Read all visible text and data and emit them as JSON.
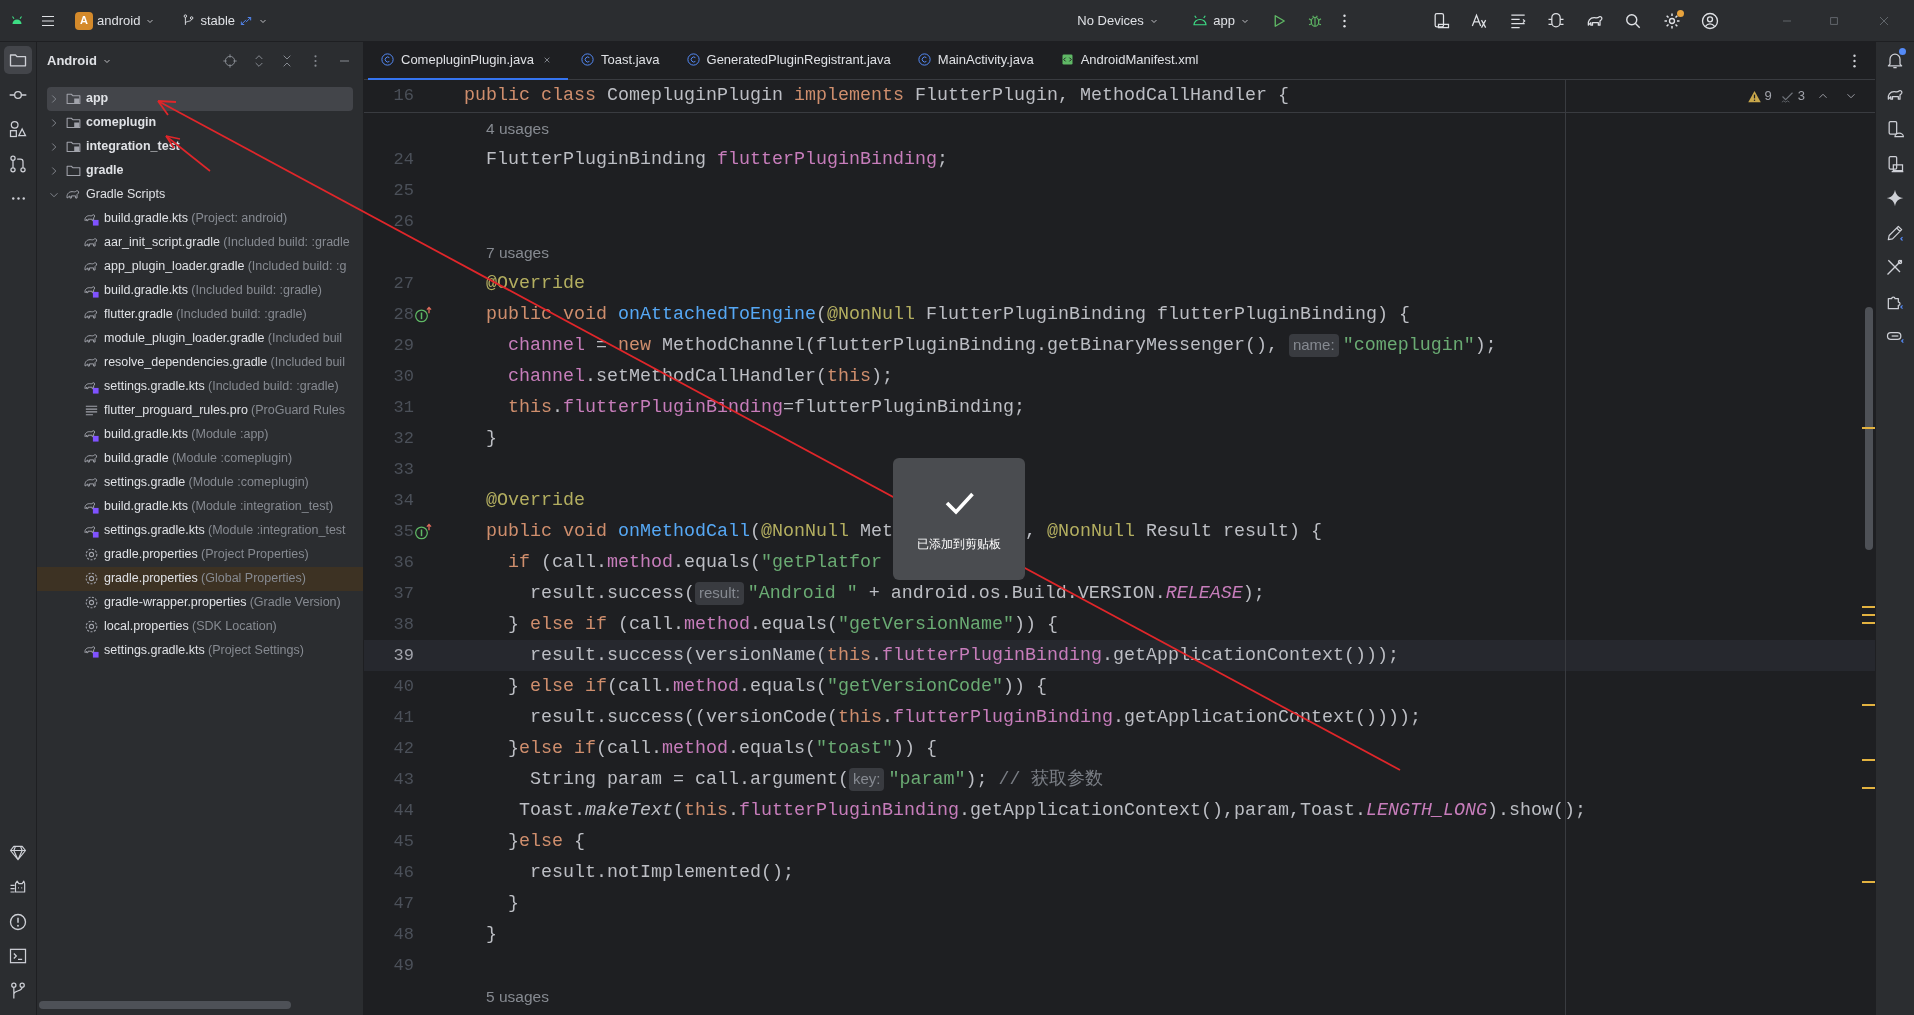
{
  "title_bar": {
    "project_initial": "A",
    "project": "android",
    "branch": "stable",
    "device": "No Devices",
    "run_config": "app",
    "update_available": true
  },
  "tool_strip_left": [
    {
      "kind": "project",
      "selected": true
    },
    {
      "kind": "commit",
      "selected": false
    },
    {
      "kind": "resources",
      "selected": false
    },
    {
      "kind": "pull-requests",
      "selected": false
    },
    {
      "kind": "more",
      "selected": false
    }
  ],
  "tool_strip_left_bottom": [
    {
      "kind": "gem",
      "selected": false
    },
    {
      "kind": "cat",
      "selected": false
    },
    {
      "kind": "problems",
      "selected": false
    },
    {
      "kind": "terminal",
      "selected": false
    },
    {
      "kind": "git",
      "selected": false
    }
  ],
  "tool_strip_right": [
    {
      "kind": "notifications",
      "selected": false,
      "badge": true
    },
    {
      "kind": "gradle",
      "selected": false,
      "badge": false
    },
    {
      "kind": "device-manager",
      "selected": false,
      "badge": false
    },
    {
      "kind": "running-devices",
      "selected": false,
      "badge": false
    },
    {
      "kind": "sparkle",
      "selected": false,
      "badge": false
    },
    {
      "kind": "pencil",
      "selected": false,
      "badge": false
    },
    {
      "kind": "tools",
      "selected": false,
      "badge": false
    },
    {
      "kind": "puzzle",
      "selected": false,
      "badge": false
    },
    {
      "kind": "link",
      "selected": false,
      "badge": false
    }
  ],
  "project_panel": {
    "title": "Android",
    "tree": [
      {
        "label": "app",
        "kind": "module",
        "selected": true,
        "expanded": false
      },
      {
        "label": "comeplugin",
        "kind": "module",
        "selected": false,
        "expanded": false
      },
      {
        "label": "integration_test",
        "kind": "module",
        "selected": false,
        "expanded": false
      },
      {
        "label": "gradle",
        "kind": "folder",
        "selected": false,
        "expanded": false
      },
      {
        "label": "Gradle Scripts",
        "kind": "scripts",
        "selected": false,
        "expanded": true,
        "children": [
          {
            "label": "build.gradle.kts",
            "detail": "(Project: android)",
            "kind": "gradle-kts",
            "highlighted": false
          },
          {
            "label": "aar_init_script.gradle",
            "detail": "(Included build: :gradle",
            "kind": "gradle",
            "highlighted": false
          },
          {
            "label": "app_plugin_loader.gradle",
            "detail": "(Included build: :g",
            "kind": "gradle",
            "highlighted": false
          },
          {
            "label": "build.gradle.kts",
            "detail": "(Included build: :gradle)",
            "kind": "gradle-kts",
            "highlighted": false
          },
          {
            "label": "flutter.gradle",
            "detail": "(Included build: :gradle)",
            "kind": "gradle",
            "highlighted": false
          },
          {
            "label": "module_plugin_loader.gradle",
            "detail": "(Included buil",
            "kind": "gradle",
            "highlighted": false
          },
          {
            "label": "resolve_dependencies.gradle",
            "detail": "(Included buil",
            "kind": "gradle",
            "highlighted": false
          },
          {
            "label": "settings.gradle.kts",
            "detail": "(Included build: :gradle)",
            "kind": "gradle-kts",
            "highlighted": false
          },
          {
            "label": "flutter_proguard_rules.pro",
            "detail": "(ProGuard Rules",
            "kind": "text",
            "highlighted": false
          },
          {
            "label": "build.gradle.kts",
            "detail": "(Module :app)",
            "kind": "gradle-kts",
            "highlighted": false
          },
          {
            "label": "build.gradle",
            "detail": "(Module :comeplugin)",
            "kind": "gradle",
            "highlighted": false
          },
          {
            "label": "settings.gradle",
            "detail": "(Module :comeplugin)",
            "kind": "gradle",
            "highlighted": false
          },
          {
            "label": "build.gradle.kts",
            "detail": "(Module :integration_test)",
            "kind": "gradle-kts",
            "highlighted": false
          },
          {
            "label": "settings.gradle.kts",
            "detail": "(Module :integration_test",
            "kind": "gradle-kts",
            "highlighted": false
          },
          {
            "label": "gradle.properties",
            "detail": "(Project Properties)",
            "kind": "properties",
            "highlighted": false
          },
          {
            "label": "gradle.properties",
            "detail": "(Global Properties)",
            "kind": "properties",
            "highlighted": true
          },
          {
            "label": "gradle-wrapper.properties",
            "detail": "(Gradle Version)",
            "kind": "properties",
            "highlighted": false
          },
          {
            "label": "local.properties",
            "detail": "(SDK Location)",
            "kind": "properties",
            "highlighted": false
          },
          {
            "label": "settings.gradle.kts",
            "detail": "(Project Settings)",
            "kind": "gradle-kts",
            "highlighted": false
          }
        ]
      }
    ]
  },
  "editor": {
    "tabs": [
      {
        "label": "ComepluginPlugin.java",
        "kind": "java",
        "selected": true
      },
      {
        "label": "Toast.java",
        "kind": "java",
        "selected": false
      },
      {
        "label": "GeneratedPluginRegistrant.java",
        "kind": "java",
        "selected": false
      },
      {
        "label": "MainActivity.java",
        "kind": "java",
        "selected": false
      },
      {
        "label": "AndroidManifest.xml",
        "kind": "xml",
        "selected": false
      }
    ],
    "inspections": {
      "warnings": "9",
      "weak_warnings": "3"
    },
    "lines": [
      {
        "kind": "code",
        "number": "16",
        "sticky": true,
        "current": false,
        "implements_marker": false,
        "tokens": [
          {
            "kind": "kw",
            "text": "public class "
          },
          {
            "kind": "plain",
            "text": "ComepluginPlugin "
          },
          {
            "kind": "kw",
            "text": "implements "
          },
          {
            "kind": "plain",
            "text": "FlutterPlugin, MethodCallHandler {"
          }
        ]
      },
      {
        "kind": "usages",
        "text": "4 usages"
      },
      {
        "kind": "code",
        "number": "24",
        "sticky": false,
        "current": false,
        "implements_marker": false,
        "tokens": [
          {
            "kind": "plain",
            "text": "  FlutterPluginBinding "
          },
          {
            "kind": "field",
            "text": "flutterPluginBinding"
          },
          {
            "kind": "plain",
            "text": ";"
          }
        ]
      },
      {
        "kind": "code",
        "number": "25",
        "sticky": false,
        "current": false,
        "implements_marker": false
      },
      {
        "kind": "code",
        "number": "26",
        "sticky": false,
        "current": false,
        "implements_marker": false
      },
      {
        "kind": "usages",
        "text": "7 usages"
      },
      {
        "kind": "code",
        "number": "27",
        "sticky": false,
        "current": false,
        "implements_marker": false,
        "tokens": [
          {
            "kind": "ann",
            "text": "  @Override"
          }
        ]
      },
      {
        "kind": "code",
        "number": "28",
        "sticky": false,
        "current": false,
        "implements_marker": true,
        "tokens": [
          {
            "kind": "kw",
            "text": "  public void "
          },
          {
            "kind": "fn",
            "text": "onAttachedToEngine"
          },
          {
            "kind": "plain",
            "text": "("
          },
          {
            "kind": "ann",
            "text": "@NonNull"
          },
          {
            "kind": "plain",
            "text": " FlutterPluginBinding flutterPluginBinding) {"
          }
        ]
      },
      {
        "kind": "code",
        "number": "29",
        "sticky": false,
        "current": false,
        "implements_marker": false,
        "tokens": [
          {
            "kind": "field",
            "text": "    channel"
          },
          {
            "kind": "plain",
            "text": " = "
          },
          {
            "kind": "kw",
            "text": "new "
          },
          {
            "kind": "plain",
            "text": "MethodChannel(flutterPluginBinding.getBinaryMessenger(), "
          },
          {
            "kind": "hint",
            "text": "name:"
          },
          {
            "kind": "str",
            "text": "\"comeplugin\""
          },
          {
            "kind": "plain",
            "text": ");"
          }
        ]
      },
      {
        "kind": "code",
        "number": "30",
        "sticky": false,
        "current": false,
        "implements_marker": false,
        "tokens": [
          {
            "kind": "field",
            "text": "    channel"
          },
          {
            "kind": "plain",
            "text": ".setMethodCallHandler("
          },
          {
            "kind": "kw",
            "text": "this"
          },
          {
            "kind": "plain",
            "text": ");"
          }
        ]
      },
      {
        "kind": "code",
        "number": "31",
        "sticky": false,
        "current": false,
        "implements_marker": false,
        "tokens": [
          {
            "kind": "kw",
            "text": "    this"
          },
          {
            "kind": "plain",
            "text": "."
          },
          {
            "kind": "field",
            "text": "flutterPluginBinding"
          },
          {
            "kind": "plain",
            "text": "=flutterPluginBinding;"
          }
        ]
      },
      {
        "kind": "code",
        "number": "32",
        "sticky": false,
        "current": false,
        "implements_marker": false,
        "tokens": [
          {
            "kind": "plain",
            "text": "  }"
          }
        ]
      },
      {
        "kind": "code",
        "number": "33",
        "sticky": false,
        "current": false,
        "implements_marker": false
      },
      {
        "kind": "code",
        "number": "34",
        "sticky": false,
        "current": false,
        "implements_marker": false,
        "tokens": [
          {
            "kind": "ann",
            "text": "  @Override"
          }
        ]
      },
      {
        "kind": "code",
        "number": "35",
        "sticky": false,
        "current": false,
        "implements_marker": true,
        "tokens": [
          {
            "kind": "kw",
            "text": "  public void "
          },
          {
            "kind": "fn",
            "text": "onMethodCall"
          },
          {
            "kind": "plain",
            "text": "("
          },
          {
            "kind": "ann",
            "text": "@NonNull"
          },
          {
            "kind": "plain",
            "text": " Met"
          }
        ],
        "after_toast": [
          {
            "kind": "plain",
            "text": ", "
          },
          {
            "kind": "ann",
            "text": "@NonNull"
          },
          {
            "kind": "plain",
            "text": " Result result) {"
          }
        ]
      },
      {
        "kind": "code",
        "number": "36",
        "sticky": false,
        "current": false,
        "implements_marker": false,
        "tokens": [
          {
            "kind": "kw",
            "text": "    if "
          },
          {
            "kind": "plain",
            "text": "(call."
          },
          {
            "kind": "field",
            "text": "method"
          },
          {
            "kind": "plain",
            "text": ".equals("
          },
          {
            "kind": "str",
            "text": "\"getPlatfor"
          }
        ]
      },
      {
        "kind": "code",
        "number": "37",
        "sticky": false,
        "current": false,
        "implements_marker": false,
        "tokens": [
          {
            "kind": "plain",
            "text": "      result.success("
          },
          {
            "kind": "hint",
            "text": "result:"
          },
          {
            "kind": "str",
            "text": "\"Android \""
          },
          {
            "kind": "plain",
            "text": " + android.os.Build.VERSION."
          },
          {
            "kind": "static",
            "text": "RELEASE"
          },
          {
            "kind": "plain",
            "text": ");"
          }
        ]
      },
      {
        "kind": "code",
        "number": "38",
        "sticky": false,
        "current": false,
        "implements_marker": false,
        "tokens": [
          {
            "kind": "plain",
            "text": "    } "
          },
          {
            "kind": "kw",
            "text": "else if "
          },
          {
            "kind": "plain",
            "text": "(call."
          },
          {
            "kind": "field",
            "text": "method"
          },
          {
            "kind": "plain",
            "text": ".equals("
          },
          {
            "kind": "str",
            "text": "\"getVersionName\""
          },
          {
            "kind": "plain",
            "text": ")) {"
          }
        ]
      },
      {
        "kind": "code",
        "number": "39",
        "sticky": false,
        "current": true,
        "implements_marker": false,
        "tokens": [
          {
            "kind": "plain",
            "text": "      result.success(versionName("
          },
          {
            "kind": "kw",
            "text": "this"
          },
          {
            "kind": "plain",
            "text": "."
          },
          {
            "kind": "field",
            "text": "flutterPluginBinding"
          },
          {
            "kind": "plain",
            "text": ".getApplicationContext()));"
          }
        ]
      },
      {
        "kind": "code",
        "number": "40",
        "sticky": false,
        "current": false,
        "implements_marker": false,
        "tokens": [
          {
            "kind": "plain",
            "text": "    } "
          },
          {
            "kind": "kw",
            "text": "else if"
          },
          {
            "kind": "plain",
            "text": "(call."
          },
          {
            "kind": "field",
            "text": "method"
          },
          {
            "kind": "plain",
            "text": ".equals("
          },
          {
            "kind": "str",
            "text": "\"getVersionCode\""
          },
          {
            "kind": "plain",
            "text": ")) {"
          }
        ]
      },
      {
        "kind": "code",
        "number": "41",
        "sticky": false,
        "current": false,
        "implements_marker": false,
        "tokens": [
          {
            "kind": "plain",
            "text": "      result.success((versionCode("
          },
          {
            "kind": "kw",
            "text": "this"
          },
          {
            "kind": "plain",
            "text": "."
          },
          {
            "kind": "field",
            "text": "flutterPluginBinding"
          },
          {
            "kind": "plain",
            "text": ".getApplicationContext())));"
          }
        ]
      },
      {
        "kind": "code",
        "number": "42",
        "sticky": false,
        "current": false,
        "implements_marker": false,
        "tokens": [
          {
            "kind": "plain",
            "text": "    }"
          },
          {
            "kind": "kw",
            "text": "else if"
          },
          {
            "kind": "plain",
            "text": "(call."
          },
          {
            "kind": "field",
            "text": "method"
          },
          {
            "kind": "plain",
            "text": ".equals("
          },
          {
            "kind": "str",
            "text": "\"toast\""
          },
          {
            "kind": "plain",
            "text": ")) {"
          }
        ]
      },
      {
        "kind": "code",
        "number": "43",
        "sticky": false,
        "current": false,
        "implements_marker": false,
        "tokens": [
          {
            "kind": "plain",
            "text": "      String param = call.argument("
          },
          {
            "kind": "hint",
            "text": "key:"
          },
          {
            "kind": "str",
            "text": "\"param\""
          },
          {
            "kind": "plain",
            "text": "); "
          },
          {
            "kind": "comment",
            "text": "// 获取参数"
          }
        ]
      },
      {
        "kind": "code",
        "number": "44",
        "sticky": false,
        "current": false,
        "implements_marker": false,
        "tokens": [
          {
            "kind": "plain",
            "text": "     Toast."
          },
          {
            "kind": "italic",
            "text": "makeText"
          },
          {
            "kind": "plain",
            "text": "("
          },
          {
            "kind": "kw",
            "text": "this"
          },
          {
            "kind": "plain",
            "text": "."
          },
          {
            "kind": "field",
            "text": "flutterPluginBinding"
          },
          {
            "kind": "plain",
            "text": ".getApplicationContext(),param,Toast."
          },
          {
            "kind": "static",
            "text": "LENGTH_LONG"
          },
          {
            "kind": "plain",
            "text": ").show();"
          }
        ]
      },
      {
        "kind": "code",
        "number": "45",
        "sticky": false,
        "current": false,
        "implements_marker": false,
        "tokens": [
          {
            "kind": "plain",
            "text": "    }"
          },
          {
            "kind": "kw",
            "text": "else "
          },
          {
            "kind": "plain",
            "text": "{"
          }
        ]
      },
      {
        "kind": "code",
        "number": "46",
        "sticky": false,
        "current": false,
        "implements_marker": false,
        "tokens": [
          {
            "kind": "plain",
            "text": "      result.notImplemented();"
          }
        ]
      },
      {
        "kind": "code",
        "number": "47",
        "sticky": false,
        "current": false,
        "implements_marker": false,
        "tokens": [
          {
            "kind": "plain",
            "text": "    }"
          }
        ]
      },
      {
        "kind": "code",
        "number": "48",
        "sticky": false,
        "current": false,
        "implements_marker": false,
        "tokens": [
          {
            "kind": "plain",
            "text": "  }"
          }
        ]
      },
      {
        "kind": "code",
        "number": "49",
        "sticky": false,
        "current": false,
        "implements_marker": false
      },
      {
        "kind": "usages",
        "text": "5 usages"
      }
    ]
  },
  "toast": {
    "text": "已添加到剪贴板"
  }
}
